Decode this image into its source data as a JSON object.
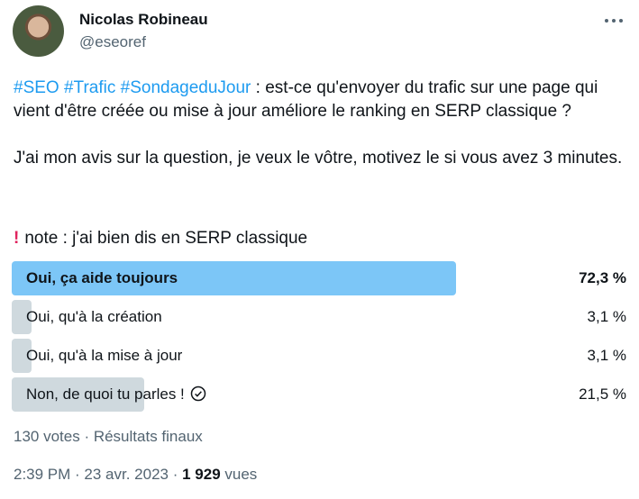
{
  "author": {
    "name": "Nicolas Robineau",
    "handle": "@eseoref"
  },
  "tweet": {
    "hashtags": [
      "#SEO",
      "#Trafic",
      "#SondageduJour"
    ],
    "line1_rest": " : est-ce qu'envoyer du trafic sur une page qui vient d'être créée ou mise à jour améliore le ranking en SERP classique ?",
    "paragraph2": "J'ai mon avis sur la question, je veux le vôtre, motivez le si vous avez 3 minutes.",
    "note_text": "note : j'ai bien dis en SERP classique",
    "note_icon": "exclamation-icon"
  },
  "poll": {
    "options": [
      {
        "label": "Oui, ça aide toujours",
        "percent_text": "72,3 %",
        "percent": 72.3,
        "winner": true
      },
      {
        "label": "Oui, qu'à la création",
        "percent_text": "3,1 %",
        "percent": 3.1,
        "winner": false
      },
      {
        "label": "Oui, qu'à la mise à jour",
        "percent_text": "3,1 %",
        "percent": 3.1,
        "winner": false
      },
      {
        "label": "Non, de quoi tu parles !",
        "percent_text": "21,5 %",
        "percent": 21.5,
        "winner": false,
        "check_icon": "check-circle-icon"
      }
    ],
    "footer": "130 votes · Résultats finaux"
  },
  "meta": {
    "time_date": "2:39 PM · 23 avr. 2023 · ",
    "views_count": "1 929",
    "views_label": " vues"
  },
  "colors": {
    "accent": "#1d9bf0",
    "winner_bar": "#7cc6f7",
    "bar": "#cfd9de",
    "secondary_text": "#536471"
  }
}
